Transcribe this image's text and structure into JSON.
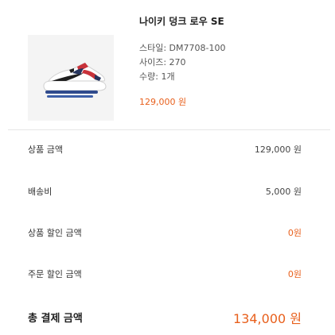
{
  "product": {
    "name": "나이키 덩크 로우 SE",
    "style": "스타일: DM7708-100",
    "size": "사이즈: 270",
    "quantity": "수량: 1개",
    "price": "129,000 원",
    "image_alt": "nike-sneaker"
  },
  "summary": {
    "subtotal_label": "상품 금액",
    "subtotal_value": "129,000 원",
    "shipping_label": "배송비",
    "shipping_value": "5,000 원",
    "product_discount_label": "상품 할인 금액",
    "product_discount_value": "0원",
    "order_discount_label": "주문 할인 금액",
    "order_discount_value": "0원",
    "total_label": "총 결제 금액",
    "total_value": "134,000 원"
  },
  "colors": {
    "accent": "#e8601d",
    "divider": "#e6e6e6",
    "thumb_bg": "#f4f4f4"
  }
}
